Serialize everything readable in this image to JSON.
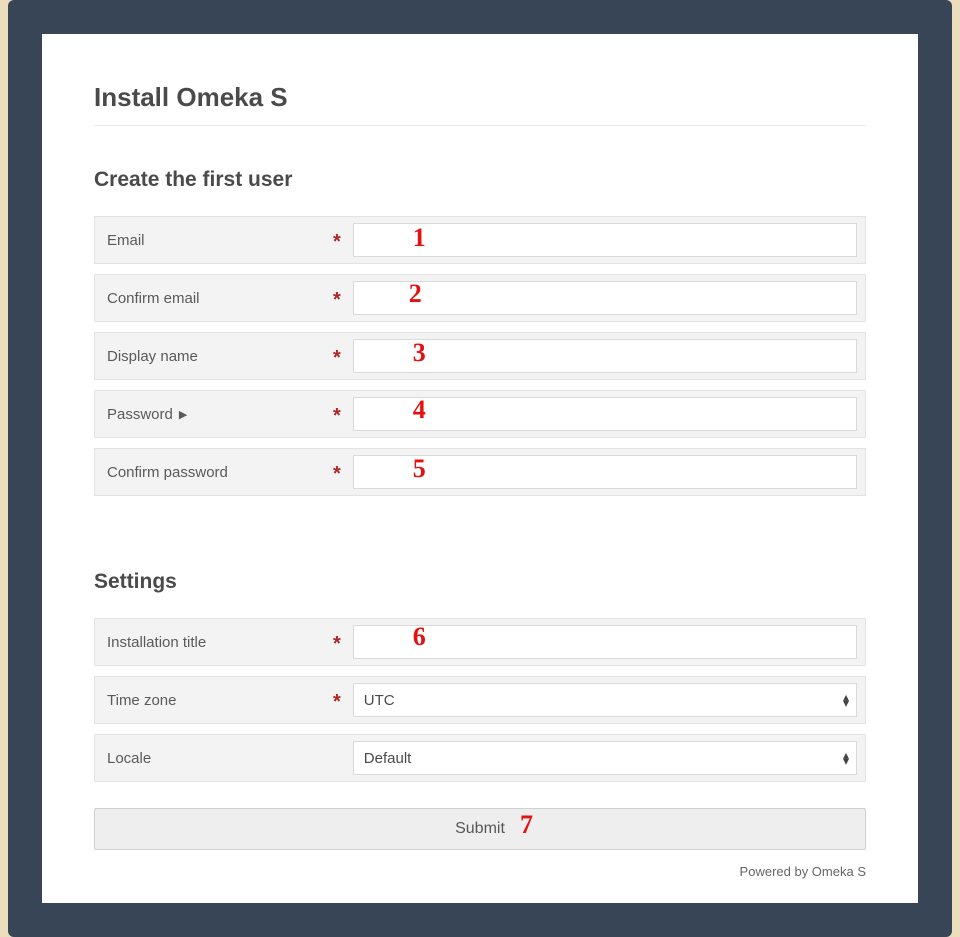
{
  "page": {
    "title": "Install Omeka S",
    "footer": "Powered by Omeka S"
  },
  "sections": {
    "user": {
      "heading": "Create the first user",
      "fields": {
        "email": {
          "label": "Email",
          "required": true,
          "value": "",
          "annot": "1"
        },
        "confirm_email": {
          "label": "Confirm email",
          "required": true,
          "value": "",
          "annot": "2"
        },
        "display_name": {
          "label": "Display name",
          "required": true,
          "value": "",
          "annot": "3"
        },
        "password": {
          "label": "Password",
          "required": true,
          "value": "",
          "expandable": true,
          "annot": "4"
        },
        "confirm_password": {
          "label": "Confirm password",
          "required": true,
          "value": "",
          "annot": "5"
        }
      }
    },
    "settings": {
      "heading": "Settings",
      "fields": {
        "install_title": {
          "label": "Installation title",
          "required": true,
          "value": "",
          "annot": "6"
        },
        "time_zone": {
          "label": "Time zone",
          "required": true,
          "selected": "UTC"
        },
        "locale": {
          "label": "Locale",
          "required": false,
          "selected": "Default"
        }
      }
    }
  },
  "submit": {
    "label": "Submit",
    "annot": "7"
  },
  "required_marker": "*"
}
